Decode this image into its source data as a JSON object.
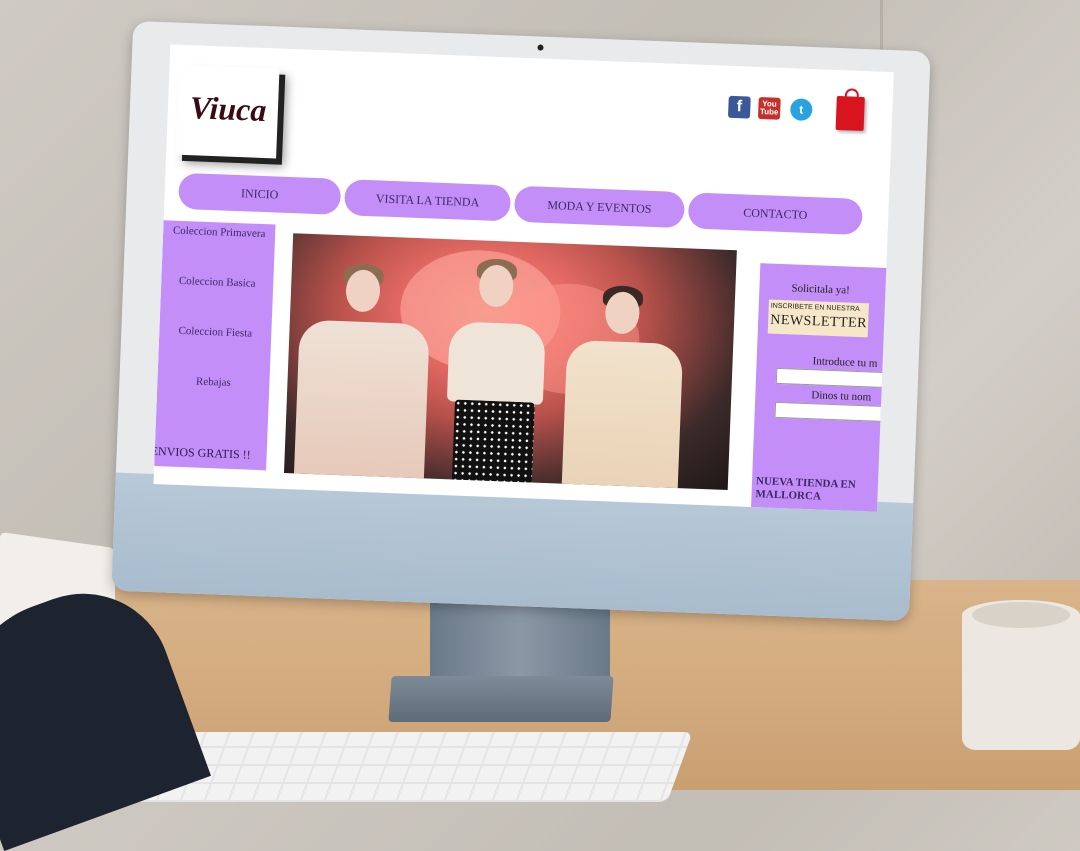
{
  "site": {
    "logo": "Viuca",
    "social": [
      {
        "name": "facebook-icon",
        "glyph": "f"
      },
      {
        "name": "youtube-icon",
        "glyph": "You Tube"
      },
      {
        "name": "twitter-icon",
        "glyph": "t"
      }
    ],
    "cart_icon": "shopping-bag-icon",
    "nav": [
      "INICIO",
      "VISITA LA TIENDA",
      "MODA Y EVENTOS",
      "CONTACTO"
    ],
    "sidebar_left": {
      "links": [
        "Coleccion Primavera",
        "Coleccion Basica",
        "Coleccion Fiesta",
        "Rebajas"
      ],
      "footer": "ENVIOS GRATIS !!"
    },
    "sidebar_right": {
      "cta": "Solicitala ya!",
      "newsletter_small": "INSCRIBETE EN NUESTRA",
      "newsletter_big": "NEWSLETTER",
      "email_label": "Introduce tu m",
      "name_label": "Dinos tu nom",
      "store_news": "NUEVA TIENDA EN MALLORCA"
    }
  },
  "colors": {
    "accent_purple": "#c48ef8",
    "logo_text": "#3c0a12"
  }
}
